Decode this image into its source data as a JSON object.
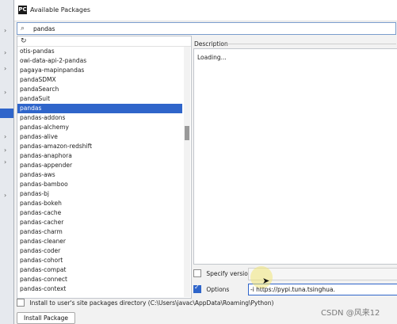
{
  "window": {
    "title": "Available Packages",
    "icon": "pycharm-icon"
  },
  "search": {
    "value": "pandas"
  },
  "packages": [
    "otis-pandas",
    "owi-data-api-2-pandas",
    "pagaya-mapinpandas",
    "pandaSDMX",
    "pandaSearch",
    "pandaSuit",
    "pandas",
    "pandas-addons",
    "pandas-alchemy",
    "pandas-alive",
    "pandas-amazon-redshift",
    "pandas-anaphora",
    "pandas-appender",
    "pandas-aws",
    "pandas-bamboo",
    "pandas-bj",
    "pandas-bokeh",
    "pandas-cache",
    "pandas-cacher",
    "pandas-charm",
    "pandas-cleaner",
    "pandas-coder",
    "pandas-cohort",
    "pandas-compat",
    "pandas-connect",
    "pandas-context"
  ],
  "selected_package": "pandas",
  "description": {
    "label": "Description",
    "text": "Loading..."
  },
  "specify_version": {
    "label": "Specify version",
    "checked": false
  },
  "options": {
    "label": "Options",
    "checked": true,
    "value": "-i https://pypi.tuna.tsinghua."
  },
  "install_to_user": {
    "label": "Install to user's site packages directory (C:\\Users\\javac\\AppData\\Roaming\\Python)",
    "checked": false
  },
  "install_button": "Install Package",
  "watermark": "CSDN @风来12"
}
